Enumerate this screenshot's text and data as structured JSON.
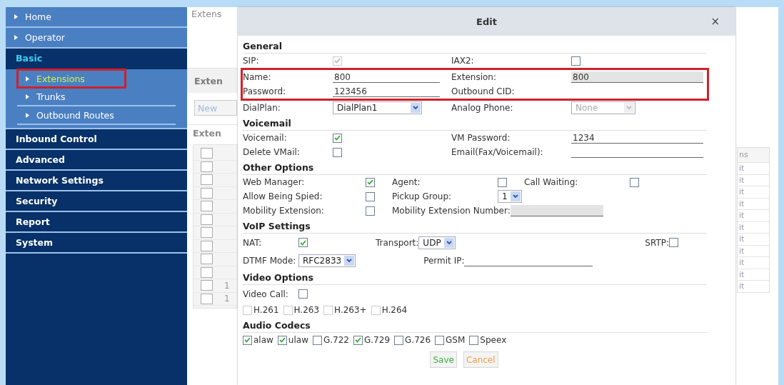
{
  "sidebar": {
    "items": [
      {
        "label": "Home",
        "kind": "link"
      },
      {
        "label": "Operator",
        "kind": "link"
      },
      {
        "label": "Basic",
        "kind": "section",
        "expanded": true,
        "children": [
          {
            "label": "Extensions",
            "selected": true,
            "highlight": true
          },
          {
            "label": "Trunks",
            "selected": false,
            "highlight": false
          },
          {
            "label": "Outbound Routes",
            "selected": false,
            "highlight": false
          }
        ]
      },
      {
        "label": "Inbound Control",
        "kind": "section",
        "expanded": false
      },
      {
        "label": "Advanced",
        "kind": "section",
        "expanded": false
      },
      {
        "label": "Network Settings",
        "kind": "section",
        "expanded": false
      },
      {
        "label": "Security",
        "kind": "section",
        "expanded": false
      },
      {
        "label": "Report",
        "kind": "section",
        "expanded": false
      },
      {
        "label": "System",
        "kind": "section",
        "expanded": false
      }
    ]
  },
  "background_left": {
    "title": "Extens",
    "tab": "Exten",
    "button": "New",
    "table_title": "Exten",
    "header_checked": false,
    "rows": [
      {
        "checked": false,
        "cell": ""
      },
      {
        "checked": false,
        "cell": ""
      },
      {
        "checked": false,
        "cell": ""
      },
      {
        "checked": false,
        "cell": ""
      },
      {
        "checked": false,
        "cell": ""
      },
      {
        "checked": false,
        "cell": ""
      },
      {
        "checked": false,
        "cell": ""
      },
      {
        "checked": false,
        "cell": ""
      },
      {
        "checked": false,
        "cell": ""
      },
      {
        "checked": false,
        "cell": "1"
      },
      {
        "checked": false,
        "cell": "1"
      }
    ]
  },
  "background_right": {
    "column_header": "ns",
    "cells": [
      "it",
      "it",
      "it",
      "it",
      "it",
      "it",
      "it",
      "it",
      "it",
      "it",
      "it"
    ]
  },
  "dialog": {
    "title": "Edit",
    "close": "×",
    "sections": [
      {
        "title": "General",
        "rows": [
          {
            "kind": "grid",
            "highlight": false,
            "groups": [
              [
                {
                  "kind": "label",
                  "text": "SIP:"
                },
                {
                  "kind": "check",
                  "checked": true,
                  "disabled": true
                }
              ],
              [
                {
                  "kind": "label",
                  "text": "IAX2:"
                },
                {
                  "kind": "check",
                  "checked": false,
                  "disabled": false
                }
              ]
            ]
          },
          {
            "kind": "grid",
            "highlight": true,
            "groups": [
              [
                {
                  "kind": "label",
                  "text": "Name:"
                },
                {
                  "kind": "text",
                  "value": "800",
                  "disabled": false
                }
              ],
              [
                {
                  "kind": "label",
                  "text": "Extension:"
                },
                {
                  "kind": "text",
                  "value": "800",
                  "disabled": true
                }
              ]
            ]
          },
          {
            "kind": "grid",
            "highlight": true,
            "groups": [
              [
                {
                  "kind": "label",
                  "text": "Password:"
                },
                {
                  "kind": "text",
                  "value": "123456",
                  "disabled": false
                }
              ],
              [
                {
                  "kind": "label",
                  "text": "Outbound CID:"
                }
              ]
            ]
          },
          {
            "kind": "grid",
            "highlight": false,
            "groups": [
              [
                {
                  "kind": "label",
                  "text": "DialPlan:"
                },
                {
                  "kind": "select",
                  "value": "DialPlan1",
                  "disabled": false
                }
              ],
              [
                {
                  "kind": "label",
                  "text": "Analog Phone:"
                },
                {
                  "kind": "select",
                  "value": "None",
                  "disabled": true
                }
              ]
            ]
          }
        ]
      },
      {
        "title": "Voicemail",
        "rows": [
          {
            "kind": "grid",
            "highlight": false,
            "groups": [
              [
                {
                  "kind": "label",
                  "text": "Voicemail:"
                },
                {
                  "kind": "check",
                  "checked": true,
                  "disabled": false
                }
              ],
              [
                {
                  "kind": "label",
                  "text": "VM Password:"
                },
                {
                  "kind": "text",
                  "value": "1234",
                  "disabled": false
                }
              ]
            ]
          },
          {
            "kind": "grid",
            "highlight": false,
            "groups": [
              [
                {
                  "kind": "label",
                  "text": "Delete VMail:"
                },
                {
                  "kind": "check",
                  "checked": false,
                  "disabled": false
                }
              ],
              [
                {
                  "kind": "label",
                  "text": "Email(Fax/Voicemail):"
                },
                {
                  "kind": "text",
                  "disabled": false
                }
              ]
            ]
          }
        ]
      },
      {
        "title": "Other Options",
        "rows": [
          {
            "kind": "options",
            "highlight": false,
            "groups": [
              [
                {
                  "kind": "label",
                  "text": "Web Manager:"
                },
                {
                  "kind": "check",
                  "checked": true,
                  "disabled": false
                }
              ],
              [
                {
                  "kind": "label",
                  "text": "Agent:"
                },
                {
                  "kind": "check",
                  "checked": false,
                  "disabled": false
                }
              ],
              [
                {
                  "kind": "label",
                  "text": "Call Waiting:"
                },
                {
                  "kind": "check",
                  "checked": false,
                  "disabled": false
                }
              ]
            ]
          },
          {
            "kind": "options",
            "highlight": false,
            "groups": [
              [
                {
                  "kind": "label",
                  "text": "Allow Being Spied:"
                },
                {
                  "kind": "check",
                  "checked": false,
                  "disabled": false
                }
              ],
              [
                {
                  "kind": "label",
                  "text": "Pickup Group:"
                },
                {
                  "kind": "select",
                  "value": "1",
                  "disabled": false
                }
              ]
            ]
          },
          {
            "kind": "options",
            "highlight": false,
            "groups": [
              [
                {
                  "kind": "label",
                  "text": "Mobility Extension:"
                },
                {
                  "kind": "check",
                  "checked": false,
                  "disabled": false
                }
              ],
              [
                {
                  "kind": "label",
                  "text": "Mobility Extension Number:"
                },
                {
                  "kind": "text",
                  "disabled": true
                }
              ]
            ]
          }
        ]
      },
      {
        "title": "VoIP Settings",
        "rows": [
          {
            "kind": "spread",
            "highlight": false,
            "groups": [
              [
                {
                  "kind": "label",
                  "text": "NAT:"
                },
                {
                  "kind": "check",
                  "checked": true,
                  "disabled": false
                }
              ],
              [
                {
                  "kind": "label",
                  "text": "Transport:"
                },
                {
                  "kind": "select",
                  "value": "UDP",
                  "disabled": false
                }
              ],
              [
                {
                  "kind": "label",
                  "text": "SRTP:"
                },
                {
                  "kind": "check",
                  "checked": false,
                  "disabled": false
                }
              ]
            ]
          },
          {
            "kind": "spread",
            "highlight": false,
            "groups": [
              [
                {
                  "kind": "label",
                  "text": "DTMF Mode:"
                },
                {
                  "kind": "select",
                  "value": "RFC2833",
                  "disabled": false
                }
              ],
              [
                {
                  "kind": "label",
                  "text": "Permit IP:"
                },
                {
                  "kind": "text",
                  "disabled": false
                }
              ]
            ]
          }
        ]
      },
      {
        "title": "Video Options",
        "rows": [
          {
            "kind": "spread",
            "highlight": false,
            "groups": [
              [
                {
                  "kind": "label",
                  "text": "Video Call:"
                },
                {
                  "kind": "check",
                  "checked": false,
                  "disabled": false
                }
              ]
            ]
          },
          {
            "kind": "inline",
            "highlight": false,
            "groups": [
              [
                {
                  "kind": "check",
                  "checked": false,
                  "disabled": true
                },
                {
                  "kind": "label",
                  "text": "H.261"
                }
              ],
              [
                {
                  "kind": "check",
                  "checked": false,
                  "disabled": true
                },
                {
                  "kind": "label",
                  "text": "H.263"
                }
              ],
              [
                {
                  "kind": "check",
                  "checked": false,
                  "disabled": true
                },
                {
                  "kind": "label",
                  "text": "H.263+"
                }
              ],
              [
                {
                  "kind": "check",
                  "checked": false,
                  "disabled": true
                },
                {
                  "kind": "label",
                  "text": "H.264"
                }
              ]
            ]
          }
        ]
      },
      {
        "title": "Audio Codecs",
        "rows": [
          {
            "kind": "inline",
            "highlight": false,
            "groups": [
              [
                {
                  "kind": "check",
                  "checked": true,
                  "disabled": false
                },
                {
                  "kind": "label",
                  "text": "alaw"
                }
              ],
              [
                {
                  "kind": "check",
                  "checked": true,
                  "disabled": false
                },
                {
                  "kind": "label",
                  "text": "ulaw"
                }
              ],
              [
                {
                  "kind": "check",
                  "checked": false,
                  "disabled": false
                },
                {
                  "kind": "label",
                  "text": "G.722"
                }
              ],
              [
                {
                  "kind": "check",
                  "checked": true,
                  "disabled": false
                },
                {
                  "kind": "label",
                  "text": "G.729"
                }
              ],
              [
                {
                  "kind": "check",
                  "checked": false,
                  "disabled": false
                },
                {
                  "kind": "label",
                  "text": "G.726"
                }
              ],
              [
                {
                  "kind": "check",
                  "checked": false,
                  "disabled": false
                },
                {
                  "kind": "label",
                  "text": "GSM"
                }
              ],
              [
                {
                  "kind": "check",
                  "checked": false,
                  "disabled": false
                },
                {
                  "kind": "label",
                  "text": "Speex"
                }
              ]
            ]
          }
        ]
      }
    ],
    "buttons": [
      {
        "label": "Save",
        "kind": "save"
      },
      {
        "label": "Cancel",
        "kind": "cancel"
      }
    ]
  }
}
